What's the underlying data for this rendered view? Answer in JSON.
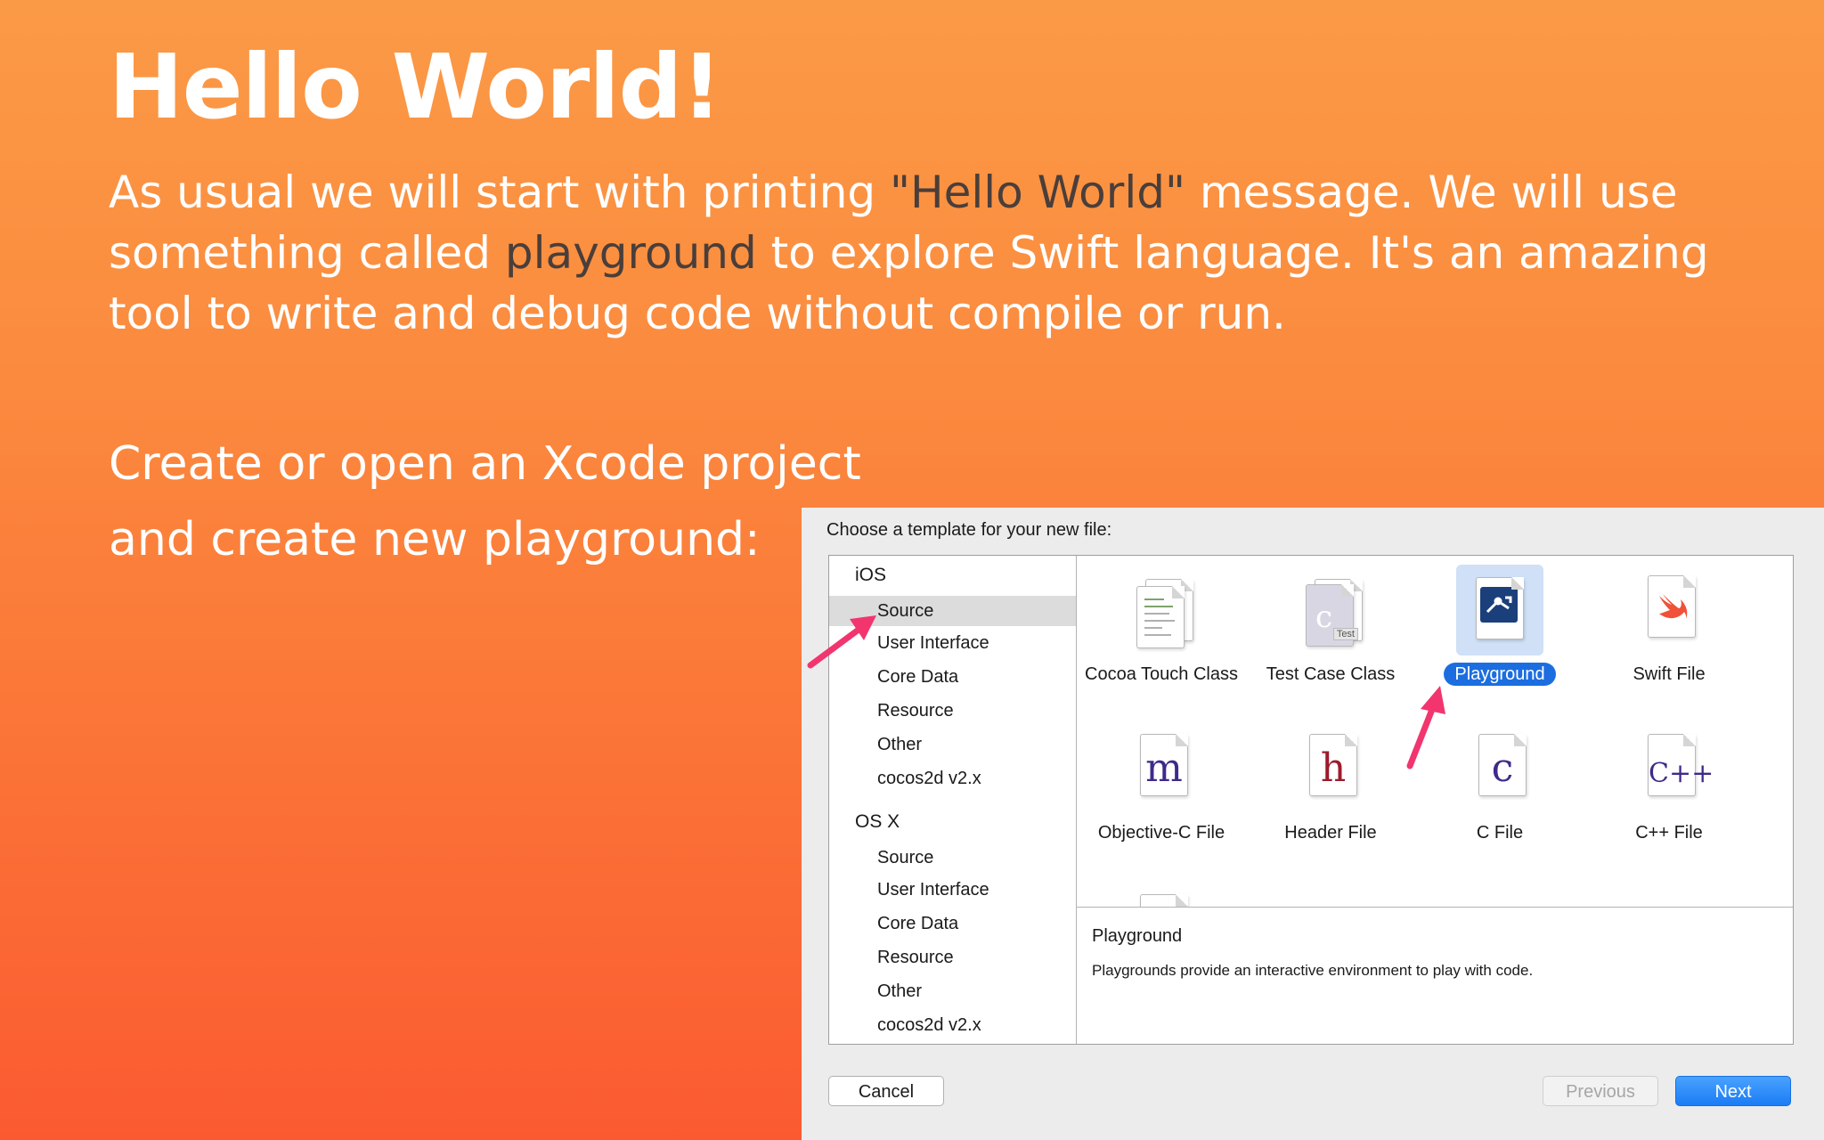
{
  "slide": {
    "title": "Hello World!",
    "intro_a": "As usual we will start with printing ",
    "intro_hl1": "\"Hello World\"",
    "intro_b": " message. We will use something called ",
    "intro_hl2": "playground",
    "intro_c": " to explore Swift language. It's an amazing tool to write and debug code without compile or run.",
    "step1": "Create or open an Xcode project",
    "step2": "and create new playground:"
  },
  "dialog": {
    "heading": "Choose a template for your new file:",
    "sidebar": {
      "ios_label": "iOS",
      "ios_items": [
        "Source",
        "User Interface",
        "Core Data",
        "Resource",
        "Other",
        "cocos2d v2.x"
      ],
      "osx_label": "OS X",
      "osx_items": [
        "Source",
        "User Interface",
        "Core Data",
        "Resource",
        "Other",
        "cocos2d v2.x"
      ],
      "selected": "iOS/Source"
    },
    "templates": [
      {
        "label": "Cocoa Touch Class",
        "icon": "cocoa-touch-class-icon"
      },
      {
        "label": "Test Case Class",
        "icon": "test-case-class-icon",
        "badge": "Test"
      },
      {
        "label": "Playground",
        "icon": "playground-icon",
        "selected": true
      },
      {
        "label": "Swift File",
        "icon": "swift-file-icon"
      },
      {
        "label": "Objective-C File",
        "icon": "objc-file-icon",
        "glyph": "m"
      },
      {
        "label": "Header File",
        "icon": "header-file-icon",
        "glyph": "h"
      },
      {
        "label": "C File",
        "icon": "c-file-icon",
        "glyph": "c"
      },
      {
        "label": "C++ File",
        "icon": "cpp-file-icon",
        "glyph": "C++"
      }
    ],
    "description": {
      "title": "Playground",
      "text": "Playgrounds provide an interactive environment to play with code."
    },
    "buttons": {
      "cancel": "Cancel",
      "previous": "Previous",
      "next": "Next"
    }
  },
  "colors": {
    "accent": "#fb8c3f",
    "selection": "#1c6ee0",
    "arrow": "#f2356f"
  }
}
